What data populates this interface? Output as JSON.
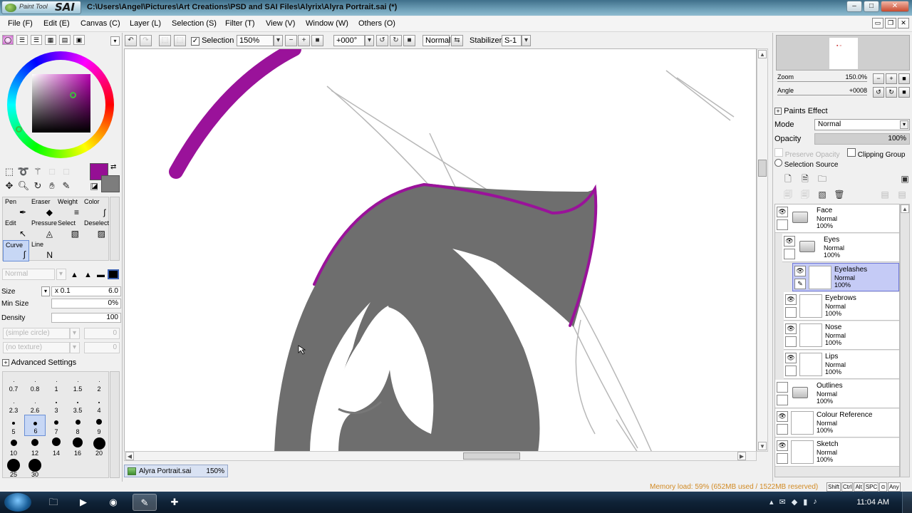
{
  "titlebar": {
    "brand": "Paint Tool",
    "brand_sai": "SAI",
    "path": "C:\\Users\\Angel\\Pictures\\Art Creations\\PSD and SAI Files\\Alyrix\\Alyra Portrait.sai (*)",
    "minimize": "–",
    "maximize": "□",
    "close": "✕"
  },
  "menu": [
    "File (F)",
    "Edit (E)",
    "Canvas (C)",
    "Layer (L)",
    "Selection (S)",
    "Filter (T)",
    "View (V)",
    "Window (W)",
    "Others (O)"
  ],
  "toolbar": {
    "selection_label": "Selection",
    "zoom": "150%",
    "angle": "+000°",
    "blend": "Normal",
    "stabilizer_label": "Stabilizer",
    "stabilizer": "S-1"
  },
  "colors": {
    "foreground": "#950f94",
    "background": "#7d7d7d",
    "stroke_purple": "#9a129a"
  },
  "tools": {
    "row1": [
      "Pen",
      "Eraser",
      "Weight",
      "Color"
    ],
    "row2": [
      "Edit",
      "Pressure",
      "Select",
      "Deselect"
    ],
    "row3": [
      "Curve",
      "Line"
    ],
    "selected": "Curve"
  },
  "brush": {
    "blend_mode": "Normal",
    "size_label": "Size",
    "size_multiplier": "x 0.1",
    "size_value": "6.0",
    "min_size_label": "Min Size",
    "min_size_value": "0%",
    "density_label": "Density",
    "density_value": "100",
    "density_fraction": 1.0,
    "shape": "(simple circle)",
    "shape_value": "0",
    "texture": "(no texture)",
    "texture_value": "0",
    "advanced": "Advanced Settings"
  },
  "sizes": [
    "0.7",
    "0.8",
    "1",
    "1.5",
    "2",
    "2.3",
    "2.6",
    "3",
    "3.5",
    "4",
    "5",
    "6",
    "7",
    "8",
    "9",
    "10",
    "12",
    "14",
    "16",
    "20",
    "25",
    "30"
  ],
  "selected_size": "6",
  "navigator": {
    "zoom_label": "Zoom",
    "zoom_value": "150.0%",
    "angle_label": "Angle",
    "angle_value": "+0008"
  },
  "paint_effect": {
    "title": "Paints Effect",
    "mode_label": "Mode",
    "mode_value": "Normal",
    "opacity_label": "Opacity",
    "opacity_value": "100%",
    "preserve_opacity": "Preserve Opacity",
    "clipping_group": "Clipping Group",
    "selection_source": "Selection Source"
  },
  "layers": [
    {
      "name": "Face",
      "mode": "Normal",
      "opacity": "100%",
      "type": "folder",
      "visible": true
    },
    {
      "name": "Eyes",
      "mode": "Normal",
      "opacity": "100%",
      "type": "folder",
      "visible": true
    },
    {
      "name": "Eyelashes",
      "mode": "Normal",
      "opacity": "100%",
      "type": "layer",
      "visible": true,
      "selected": true
    },
    {
      "name": "Eyebrows",
      "mode": "Normal",
      "opacity": "100%",
      "type": "layer",
      "visible": true
    },
    {
      "name": "Nose",
      "mode": "Normal",
      "opacity": "100%",
      "type": "layer",
      "visible": true
    },
    {
      "name": "Lips",
      "mode": "Normal",
      "opacity": "100%",
      "type": "layer",
      "visible": true
    },
    {
      "name": "Outlines",
      "mode": "Normal",
      "opacity": "100%",
      "type": "folder",
      "visible": false
    },
    {
      "name": "Colour Reference",
      "mode": "Normal",
      "opacity": "100%",
      "type": "layer",
      "visible": true
    },
    {
      "name": "Sketch",
      "mode": "Normal",
      "opacity": "100%",
      "type": "layer",
      "visible": true
    }
  ],
  "document_tab": {
    "name": "Alyra Portrait.sai",
    "zoom": "150%"
  },
  "status": {
    "memory": "Memory load: 59% (652MB used / 1522MB reserved)",
    "keys": [
      "Shift",
      "Ctrl",
      "Alt",
      "SPC",
      "⊙",
      "Any"
    ]
  },
  "taskbar": {
    "time": "11:04 AM"
  }
}
